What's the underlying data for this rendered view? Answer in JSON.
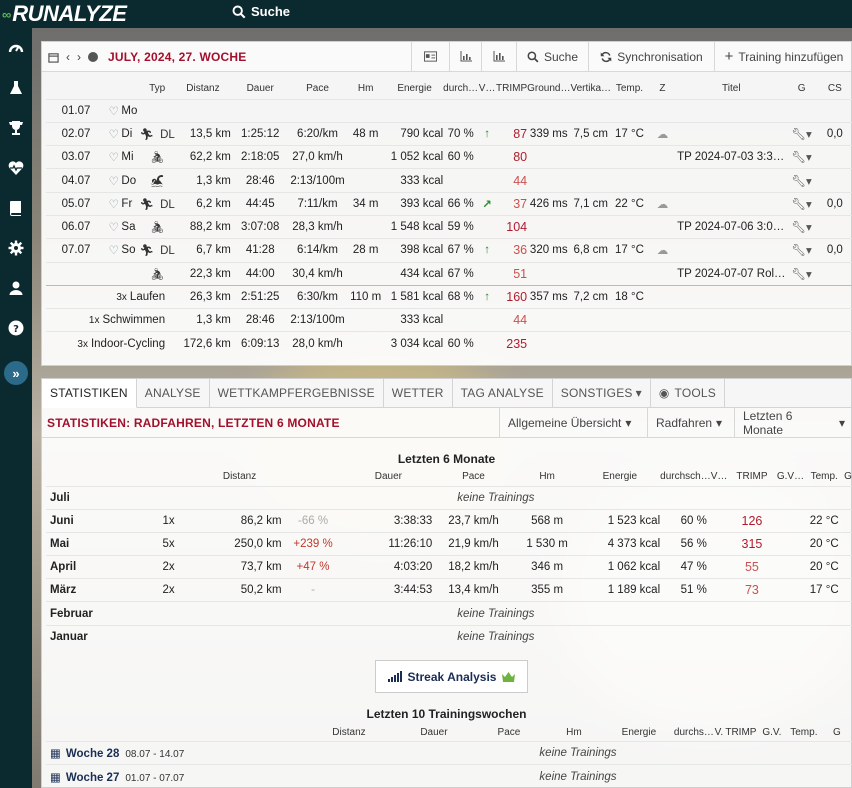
{
  "app": {
    "logo_text": "RUNALYZE",
    "search_label": "Suche"
  },
  "calendar": {
    "title": "JULY, 2024, 27. WOCHE",
    "toolbar": {
      "search_label": "Suche",
      "sync_label": "Synchronisation",
      "add_label": "Training hinzufügen"
    },
    "headers": [
      "",
      "",
      "",
      "Typ",
      "Distanz",
      "Dauer",
      "Pace",
      "Hm",
      "Energie",
      "durch…",
      "V…",
      "TRIMP",
      "Ground…",
      "Vertika…",
      "Temp.",
      "Z",
      "Titel",
      "G",
      "CS"
    ],
    "days": [
      {
        "date": "01.07",
        "day": "Mo",
        "sport": "",
        "type": "",
        "dist": "",
        "dur": "",
        "pace": "",
        "hm": "",
        "energy": "",
        "hr": "",
        "vo2": "",
        "trimp": "",
        "gct": "",
        "vo": "",
        "temp": "",
        "weather": "",
        "title": "",
        "tools": "",
        "cs": ""
      },
      {
        "date": "02.07",
        "day": "Di",
        "sport": "run",
        "type": "DL",
        "dist": "13,5 km",
        "dur": "1:25:12",
        "pace": "6:20/km",
        "hm": "48 m",
        "energy": "790 kcal",
        "hr": "70 %",
        "vo2": "up",
        "trimp": "87",
        "gct": "339 ms",
        "vo": "7,5 cm",
        "temp": "17 °C",
        "weather": "cloud",
        "title": "",
        "tools": "wrench",
        "cs": "0,0"
      },
      {
        "date": "03.07",
        "day": "Mi",
        "sport": "bike",
        "type": "",
        "dist": "62,2 km",
        "dur": "2:18:05",
        "pace": "27,0 km/h",
        "hm": "",
        "energy": "1 052 kcal",
        "hr": "60 %",
        "vo2": "",
        "trimp": "80",
        "gct": "",
        "vo": "",
        "temp": "",
        "weather": "",
        "title": "TP 2024-07-03 3:3…",
        "tools": "wrench",
        "cs": ""
      },
      {
        "date": "04.07",
        "day": "Do",
        "sport": "swim",
        "type": "",
        "dist": "1,3 km",
        "dur": "28:46",
        "pace": "2:13/100m",
        "hm": "",
        "energy": "333 kcal",
        "hr": "",
        "vo2": "",
        "trimp": "44",
        "gct": "",
        "vo": "",
        "temp": "",
        "weather": "",
        "title": "",
        "tools": "wrench",
        "cs": ""
      },
      {
        "date": "05.07",
        "day": "Fr",
        "sport": "run",
        "type": "DL",
        "dist": "6,2 km",
        "dur": "44:45",
        "pace": "7:11/km",
        "hm": "34 m",
        "energy": "393 kcal",
        "hr": "66 %",
        "vo2": "diag",
        "trimp": "37",
        "gct": "426 ms",
        "vo": "7,1 cm",
        "temp": "22 °C",
        "weather": "cloud",
        "title": "",
        "tools": "wrench",
        "cs": "0,0"
      },
      {
        "date": "06.07",
        "day": "Sa",
        "sport": "bike",
        "type": "",
        "dist": "88,2 km",
        "dur": "3:07:08",
        "pace": "28,3 km/h",
        "hm": "",
        "energy": "1 548 kcal",
        "hr": "59 %",
        "vo2": "",
        "trimp": "104",
        "gct": "",
        "vo": "",
        "temp": "",
        "weather": "",
        "title": "TP 2024-07-06 3:0…",
        "tools": "wrench",
        "cs": ""
      },
      {
        "date": "07.07",
        "day": "So",
        "sport": "run",
        "type": "DL",
        "dist": "6,7 km",
        "dur": "41:28",
        "pace": "6:14/km",
        "hm": "28 m",
        "energy": "398 kcal",
        "hr": "67 %",
        "vo2": "up",
        "trimp": "36",
        "gct": "320 ms",
        "vo": "6,8 cm",
        "temp": "17 °C",
        "weather": "cloud",
        "title": "",
        "tools": "wrench",
        "cs": "0,0"
      },
      {
        "date": "",
        "day": "",
        "sport": "bike",
        "type": "",
        "dist": "22,3 km",
        "dur": "44:00",
        "pace": "30,4 km/h",
        "hm": "",
        "energy": "434 kcal",
        "hr": "67 %",
        "vo2": "",
        "trimp": "51",
        "gct": "",
        "vo": "",
        "temp": "",
        "weather": "",
        "title": "TP 2024-07-07 Rol…",
        "tools": "wrench",
        "cs": ""
      }
    ],
    "summary": [
      {
        "count": "3x",
        "name": "Laufen",
        "dist": "26,3 km",
        "dur": "2:51:25",
        "pace": "6:30/km",
        "hm": "110 m",
        "energy": "1 581 kcal",
        "hr": "68 %",
        "vo2": "up",
        "trimp": "160",
        "gct": "357 ms",
        "vo": "7,2 cm",
        "temp": "18 °C"
      },
      {
        "count": "1x",
        "name": "Schwimmen",
        "dist": "1,3 km",
        "dur": "28:46",
        "pace": "2:13/100m",
        "hm": "",
        "energy": "333 kcal",
        "hr": "",
        "vo2": "",
        "trimp": "44",
        "gct": "",
        "vo": "",
        "temp": ""
      },
      {
        "count": "3x",
        "name": "Indoor-Cycling",
        "dist": "172,6 km",
        "dur": "6:09:13",
        "pace": "28,0 km/h",
        "hm": "",
        "energy": "3 034 kcal",
        "hr": "60 %",
        "vo2": "",
        "trimp": "235",
        "gct": "",
        "vo": "",
        "temp": ""
      }
    ]
  },
  "stats": {
    "tabs": [
      "STATISTIKEN",
      "ANALYSE",
      "WETTKAMPFERGEBNISSE",
      "WETTER",
      "TAG ANALYSE",
      "SONSTIGES",
      "TOOLS"
    ],
    "title": "STATISTIKEN: RADFAHREN, LETZTEN 6 MONATE",
    "dropdowns": [
      "Allgemeine Übersicht",
      "Radfahren",
      "Letzten 6 Monate"
    ],
    "section_title": "Letzten 6 Monate",
    "headers": [
      "",
      "",
      "Distanz",
      "",
      "Dauer",
      "Pace",
      "Hm",
      "Energie",
      "durchsch…V…",
      "TRIMP",
      "G.V…",
      "Temp.",
      "G"
    ],
    "empty_label": "keine Trainings",
    "months": [
      {
        "name": "Juli",
        "count": "",
        "dist": "",
        "delta": "",
        "dur": "",
        "pace": "",
        "hm": "",
        "energy": "",
        "hr": "",
        "trimp": "",
        "temp": "",
        "empty": true
      },
      {
        "name": "Juni",
        "count": "1x",
        "dist": "86,2 km",
        "delta": "-66 %",
        "dur": "3:38:33",
        "pace": "23,7 km/h",
        "hm": "568 m",
        "energy": "1 523 kcal",
        "hr": "60 %",
        "trimp": "126",
        "temp": "22 °C",
        "empty": false
      },
      {
        "name": "Mai",
        "count": "5x",
        "dist": "250,0 km",
        "delta": "+239 %",
        "dur": "11:26:10",
        "pace": "21,9 km/h",
        "hm": "1 530 m",
        "energy": "4 373 kcal",
        "hr": "56 %",
        "trimp": "315",
        "temp": "20 °C",
        "empty": false
      },
      {
        "name": "April",
        "count": "2x",
        "dist": "73,7 km",
        "delta": "+47 %",
        "dur": "4:03:20",
        "pace": "18,2 km/h",
        "hm": "346 m",
        "energy": "1 062 kcal",
        "hr": "47 %",
        "trimp": "55",
        "temp": "20 °C",
        "empty": false
      },
      {
        "name": "März",
        "count": "2x",
        "dist": "50,2 km",
        "delta": "-",
        "dur": "3:44:53",
        "pace": "13,4 km/h",
        "hm": "355 m",
        "energy": "1 189 kcal",
        "hr": "51 %",
        "trimp": "73",
        "temp": "17 °C",
        "empty": false
      },
      {
        "name": "Februar",
        "count": "",
        "dist": "",
        "delta": "",
        "dur": "",
        "pace": "",
        "hm": "",
        "energy": "",
        "hr": "",
        "trimp": "",
        "temp": "",
        "empty": true
      },
      {
        "name": "Januar",
        "count": "",
        "dist": "",
        "delta": "",
        "dur": "",
        "pace": "",
        "hm": "",
        "energy": "",
        "hr": "",
        "trimp": "",
        "temp": "",
        "empty": true
      }
    ],
    "streak_label": "Streak Analysis",
    "weeks_title": "Letzten 10 Trainingswochen",
    "week_headers": [
      "",
      "Distanz",
      "Dauer",
      "Pace",
      "Hm",
      "Energie",
      "durchs…",
      "V.",
      "TRIMP",
      "G.V.",
      "Temp.",
      "G"
    ],
    "weeks": [
      {
        "name": "Woche 28",
        "range": "08.07 - 14.07",
        "empty": "keine Trainings"
      },
      {
        "name": "Woche 27",
        "range": "01.07 - 07.07",
        "empty": "keine Trainings"
      }
    ]
  },
  "colors": {
    "accent": "#a3102c",
    "nav": "#0b2a30",
    "trimp": "#b01c2e",
    "link": "#1a2d55"
  }
}
